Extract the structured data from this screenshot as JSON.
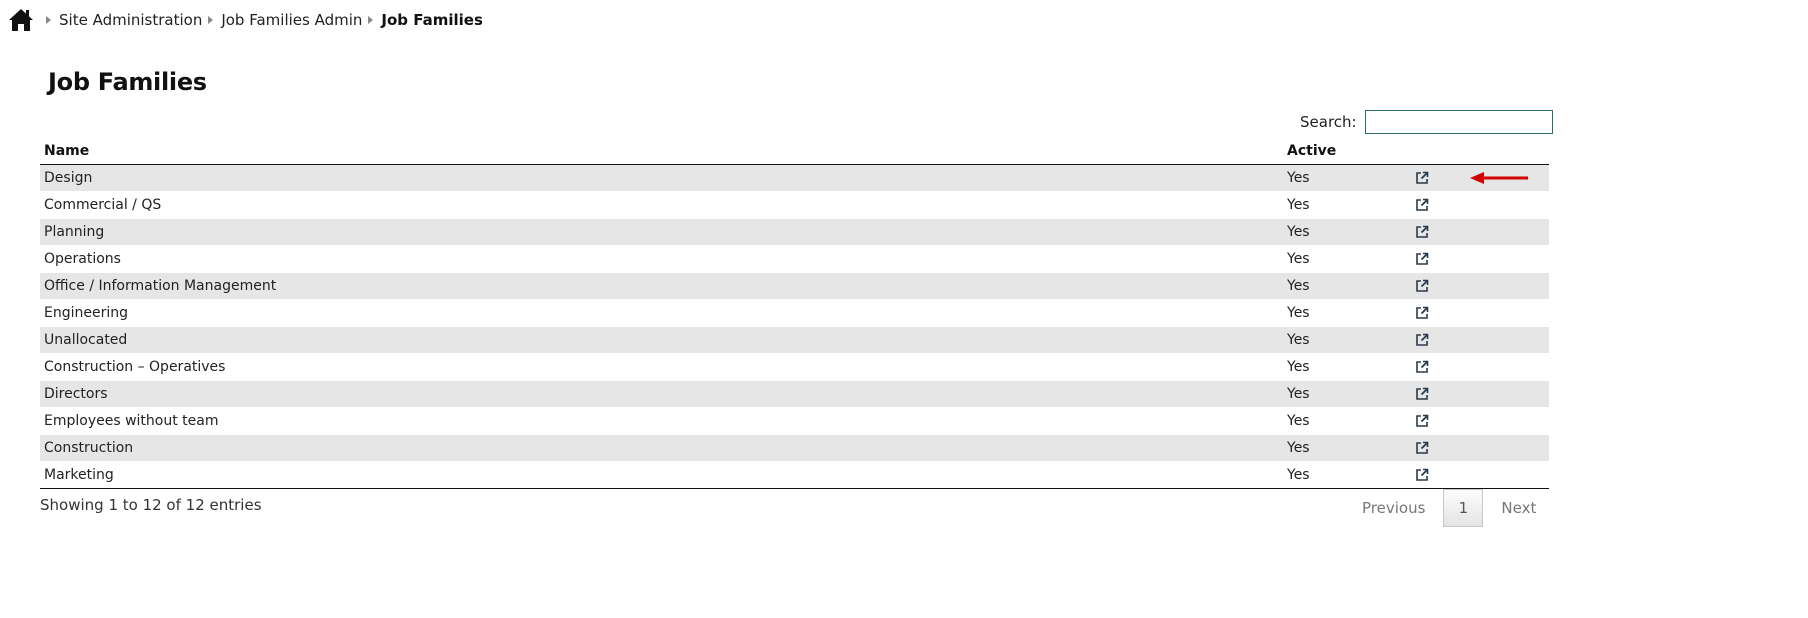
{
  "breadcrumb": {
    "home_icon": "home-icon",
    "items": [
      {
        "label": "Site Administration"
      },
      {
        "label": "Job Families Admin"
      },
      {
        "label": "Job Families"
      }
    ]
  },
  "page": {
    "title": "Job Families"
  },
  "search": {
    "label": "Search:",
    "value": "",
    "placeholder": ""
  },
  "table": {
    "columns": [
      "Name",
      "Active",
      ""
    ],
    "action_icon": "external-link-icon",
    "rows": [
      {
        "name": "Design",
        "active": "Yes"
      },
      {
        "name": "Commercial / QS",
        "active": "Yes"
      },
      {
        "name": "Planning",
        "active": "Yes"
      },
      {
        "name": "Operations",
        "active": "Yes"
      },
      {
        "name": "Office / Information Management",
        "active": "Yes"
      },
      {
        "name": "Engineering",
        "active": "Yes"
      },
      {
        "name": "Unallocated",
        "active": "Yes"
      },
      {
        "name": "Construction – Operatives",
        "active": "Yes"
      },
      {
        "name": "Directors",
        "active": "Yes"
      },
      {
        "name": "Employees without team",
        "active": "Yes"
      },
      {
        "name": "Construction",
        "active": "Yes"
      },
      {
        "name": "Marketing",
        "active": "Yes"
      }
    ]
  },
  "footer": {
    "info": "Showing 1 to 12 of 12 entries",
    "pagination": {
      "previous": "Previous",
      "current_page": "1",
      "next": "Next"
    }
  },
  "colors": {
    "row_stripe": "#e6e6e6",
    "search_border": "#2e6b6b",
    "annotation_arrow": "#d40000",
    "icon": "#2b3a4a"
  }
}
